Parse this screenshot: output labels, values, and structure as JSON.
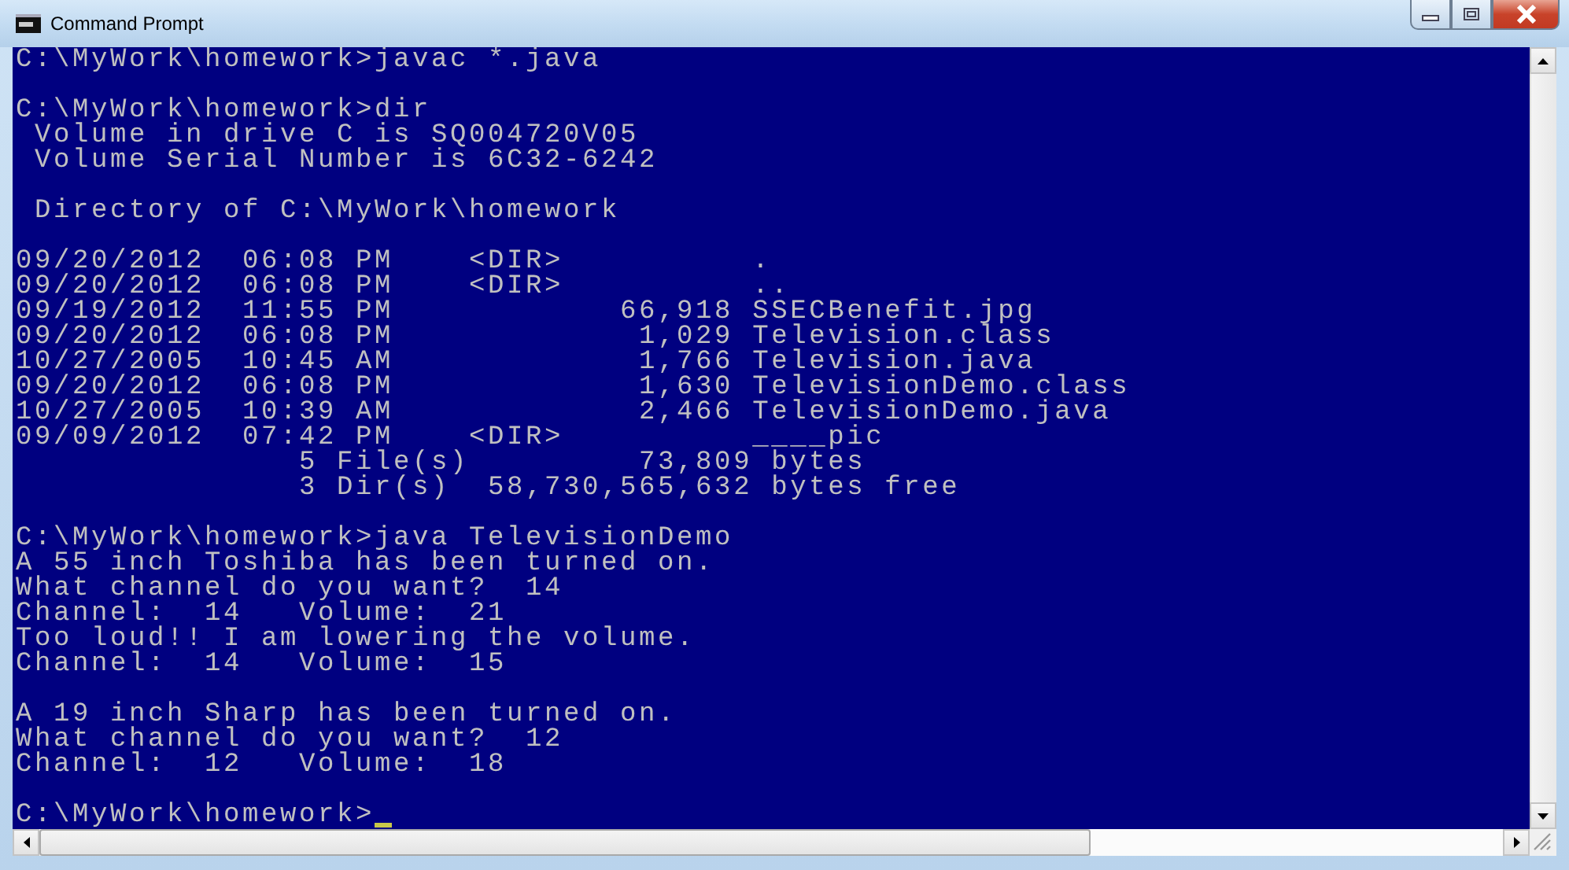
{
  "window": {
    "title": "Command Prompt"
  },
  "console": {
    "blocks": [
      {
        "lines": [
          "C:\\MyWork\\homework>javac *.java"
        ]
      },
      {
        "lines": [
          "C:\\MyWork\\homework>dir",
          " Volume in drive C is SQ004720V05",
          " Volume Serial Number is 6C32-6242"
        ]
      },
      {
        "lines": [
          " Directory of C:\\MyWork\\homework"
        ]
      },
      {
        "lines": [
          "09/20/2012  06:08 PM    <DIR>          .",
          "09/20/2012  06:08 PM    <DIR>          ..",
          "09/19/2012  11:55 PM            66,918 SSECBenefit.jpg",
          "09/20/2012  06:08 PM             1,029 Television.class",
          "10/27/2005  10:45 AM             1,766 Television.java",
          "09/20/2012  06:08 PM             1,630 TelevisionDemo.class",
          "10/27/2005  10:39 AM             2,466 TelevisionDemo.java",
          "09/09/2012  07:42 PM    <DIR>          ____pic",
          "               5 File(s)         73,809 bytes",
          "               3 Dir(s)  58,730,565,632 bytes free"
        ]
      },
      {
        "lines": [
          "C:\\MyWork\\homework>java TelevisionDemo",
          "A 55 inch Toshiba has been turned on.",
          "What channel do you want?  14",
          "Channel:  14   Volume:  21",
          "Too loud!! I am lowering the volume.",
          "Channel:  14   Volume:  15"
        ]
      },
      {
        "lines": [
          "A 19 inch Sharp has been turned on.",
          "What channel do you want?  12",
          "Channel:  12   Volume:  18"
        ]
      },
      {
        "lines": [
          "C:\\MyWork\\homework>"
        ]
      }
    ]
  }
}
